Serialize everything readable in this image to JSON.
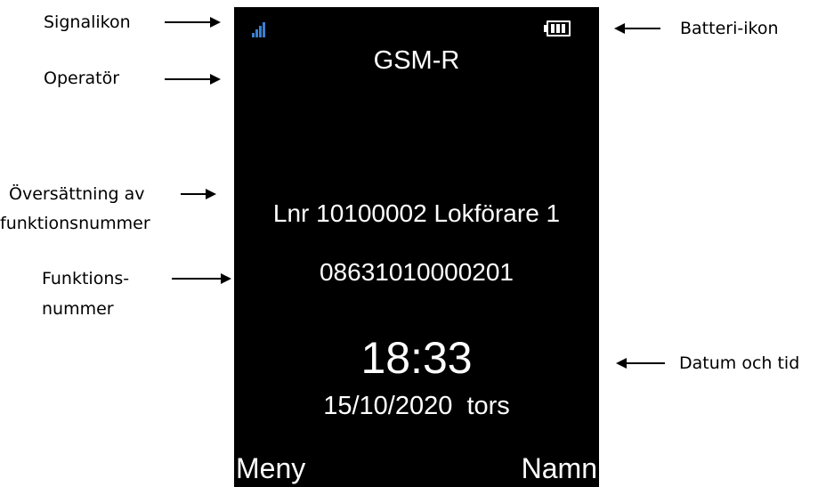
{
  "annotations": {
    "signal_icon": "Signalikon",
    "operator": "Operatör",
    "translation_line1": "Översättning av",
    "translation_line2": "funktionsnummer",
    "function_number_line1": "Funktions-",
    "function_number_line2": "nummer",
    "battery_icon": "Batteri-ikon",
    "date_time": "Datum och tid"
  },
  "screen": {
    "operator": "GSM-R",
    "function_name": "Lnr 10100002 Lokförare 1",
    "function_number": "08631010000201",
    "time": "18:33",
    "date": "15/10/2020  tors",
    "softkey_left": "Meny",
    "softkey_right": "Namn"
  },
  "icons": {
    "signal": "signal-strength-icon",
    "battery": "battery-full-icon"
  },
  "colors": {
    "screen_background": "#000000",
    "screen_text": "#ffffff",
    "signal_icon": "#3a7fd0"
  }
}
